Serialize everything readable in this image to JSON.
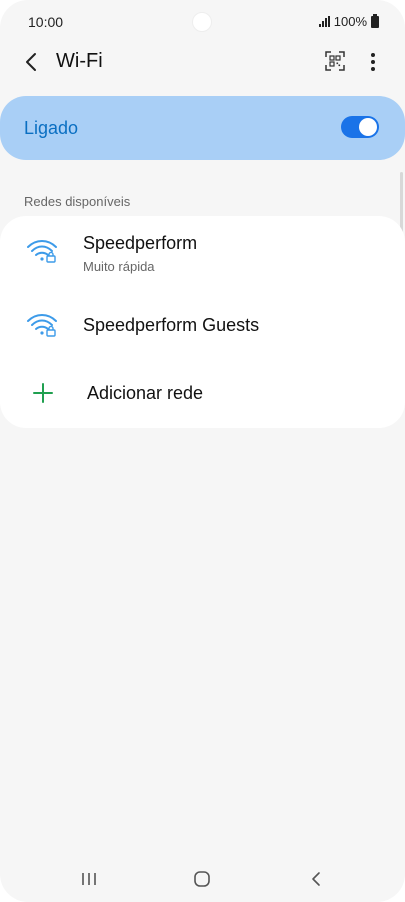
{
  "status_bar": {
    "time": "10:00",
    "battery": "100%",
    "icons": [
      "signal-icon",
      "battery-icon"
    ]
  },
  "app_bar": {
    "title": "Wi-Fi",
    "icons": [
      "back-icon",
      "qr-code-icon",
      "more-options-icon"
    ]
  },
  "wifi_toggle": {
    "label": "Ligado",
    "state": "on",
    "accent_color": "#1a73e8"
  },
  "section": {
    "header": "Redes disponíveis"
  },
  "networks": [
    {
      "name": "Speedperform",
      "subtitle": "Muito rápida",
      "icon": "wifi-lock-icon"
    },
    {
      "name": "Speedperform Guests",
      "subtitle": "",
      "icon": "wifi-lock-icon"
    }
  ],
  "add_network": {
    "label": "Adicionar rede",
    "icon": "plus-icon"
  },
  "nav_bar": {
    "icons": [
      "recents-icon",
      "home-icon",
      "back-nav-icon"
    ]
  }
}
